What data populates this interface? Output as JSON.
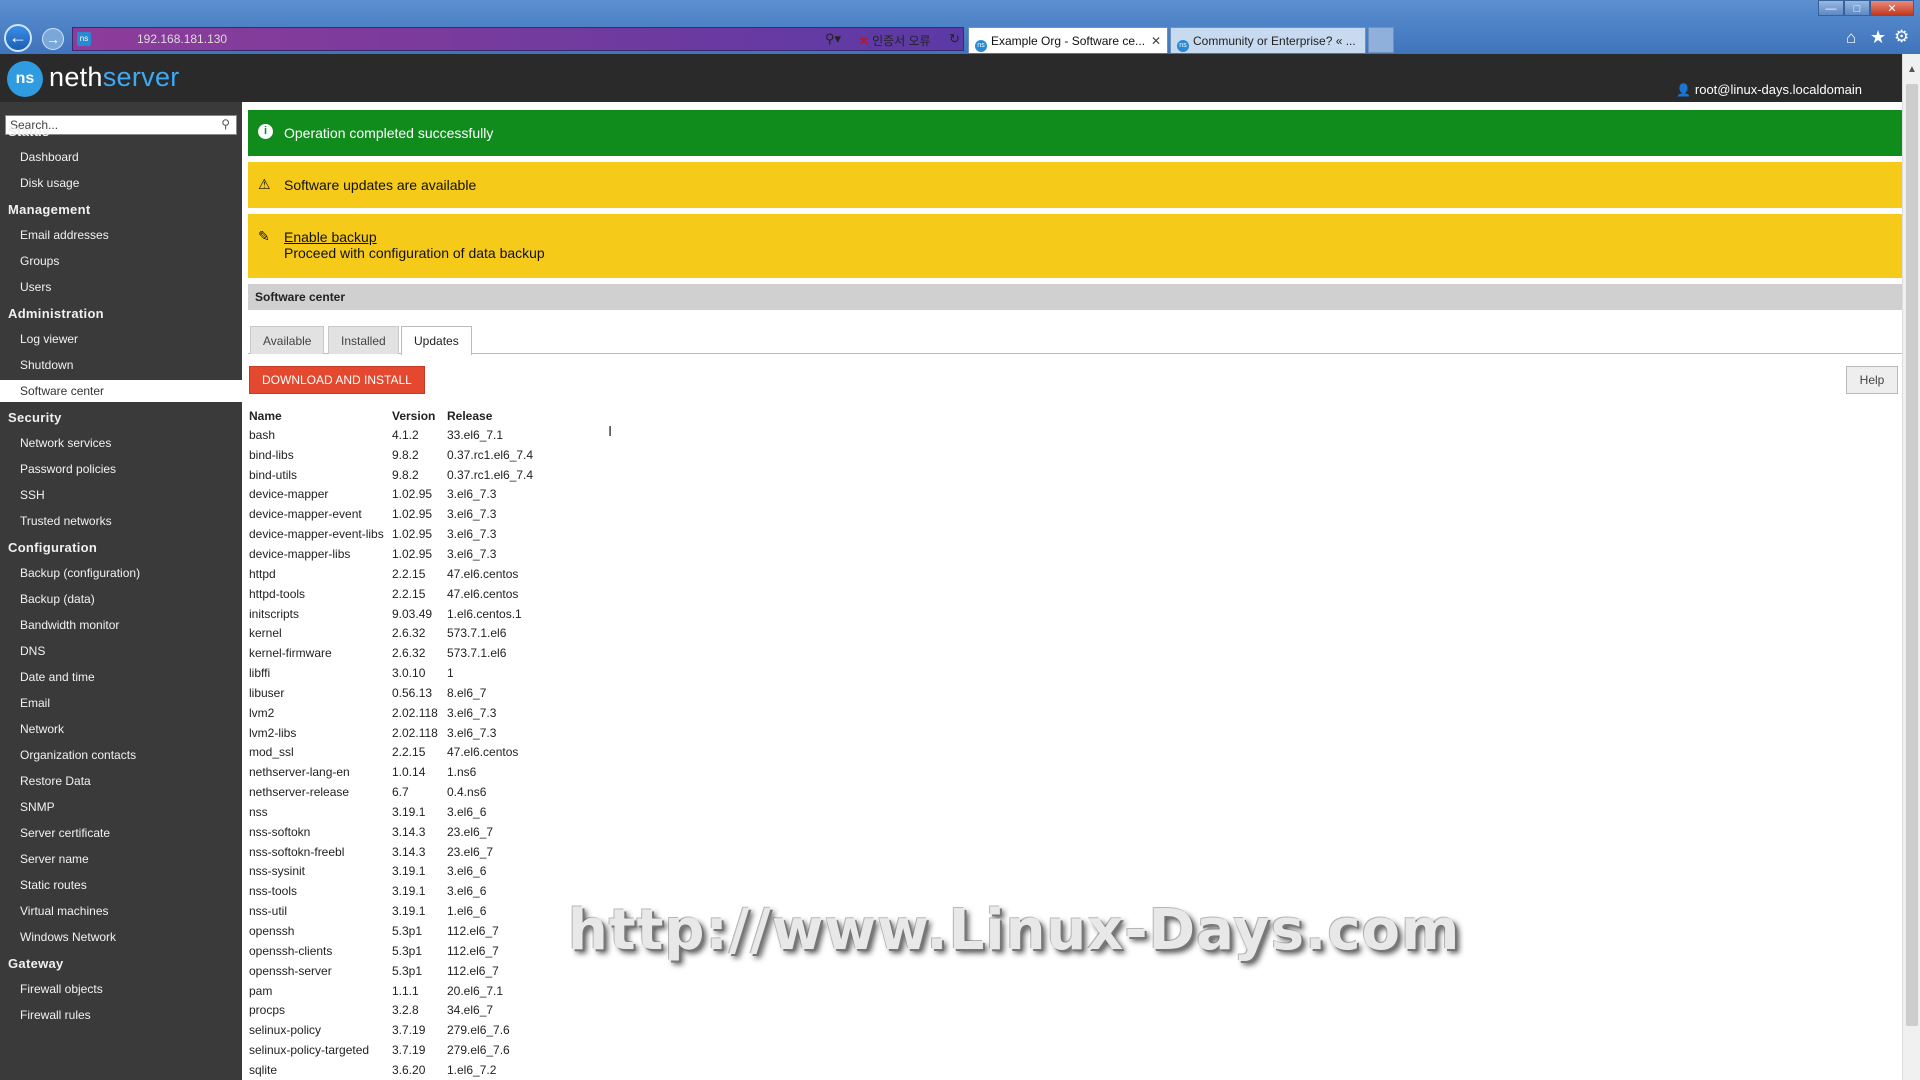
{
  "browser": {
    "url": "192.168.181.130",
    "cert_error": "인증서 오류",
    "tabs": [
      {
        "label": "Example Org - Software ce..."
      },
      {
        "label": "Community or Enterprise? « ..."
      }
    ],
    "icons": [
      "back-icon",
      "forward-icon",
      "search-icon",
      "refresh-icon",
      "home-icon",
      "star-icon",
      "gear-icon"
    ]
  },
  "header": {
    "logo_prefix": "neth",
    "logo_suffix": "server",
    "user": "root@linux-days.localdomain"
  },
  "sidebar": {
    "search_placeholder": "Search...",
    "sections": [
      {
        "title": "Status",
        "items": [
          "Dashboard",
          "Disk usage"
        ]
      },
      {
        "title": "Management",
        "items": [
          "Email addresses",
          "Groups",
          "Users"
        ]
      },
      {
        "title": "Administration",
        "items": [
          "Log viewer",
          "Shutdown",
          "Software center"
        ]
      },
      {
        "title": "Security",
        "items": [
          "Network services",
          "Password policies",
          "SSH",
          "Trusted networks"
        ]
      },
      {
        "title": "Configuration",
        "items": [
          "Backup (configuration)",
          "Backup (data)",
          "Bandwidth monitor",
          "DNS",
          "Date and time",
          "Email",
          "Network",
          "Organization contacts",
          "Restore Data",
          "SNMP",
          "Server certificate",
          "Server name",
          "Static routes",
          "Virtual machines",
          "Windows Network"
        ]
      },
      {
        "title": "Gateway",
        "items": [
          "Firewall objects",
          "Firewall rules"
        ]
      }
    ],
    "active_item": "Software center"
  },
  "alerts": {
    "success": "Operation completed successfully",
    "updates": "Software updates are available",
    "backup_link": "Enable backup",
    "backup_desc": "Proceed with configuration of data backup"
  },
  "panel": {
    "title": "Software center",
    "tabs": [
      "Available",
      "Installed",
      "Updates"
    ],
    "active_tab": "Updates",
    "download_button": "DOWNLOAD AND INSTALL",
    "help_button": "Help"
  },
  "table": {
    "columns": [
      "Name",
      "Version",
      "Release"
    ],
    "rows": [
      [
        "bash",
        "4.1.2",
        "33.el6_7.1"
      ],
      [
        "bind-libs",
        "9.8.2",
        "0.37.rc1.el6_7.4"
      ],
      [
        "bind-utils",
        "9.8.2",
        "0.37.rc1.el6_7.4"
      ],
      [
        "device-mapper",
        "1.02.95",
        "3.el6_7.3"
      ],
      [
        "device-mapper-event",
        "1.02.95",
        "3.el6_7.3"
      ],
      [
        "device-mapper-event-libs",
        "1.02.95",
        "3.el6_7.3"
      ],
      [
        "device-mapper-libs",
        "1.02.95",
        "3.el6_7.3"
      ],
      [
        "httpd",
        "2.2.15",
        "47.el6.centos"
      ],
      [
        "httpd-tools",
        "2.2.15",
        "47.el6.centos"
      ],
      [
        "initscripts",
        "9.03.49",
        "1.el6.centos.1"
      ],
      [
        "kernel",
        "2.6.32",
        "573.7.1.el6"
      ],
      [
        "kernel-firmware",
        "2.6.32",
        "573.7.1.el6"
      ],
      [
        "libffi",
        "3.0.10",
        "1"
      ],
      [
        "libuser",
        "0.56.13",
        "8.el6_7"
      ],
      [
        "lvm2",
        "2.02.118",
        "3.el6_7.3"
      ],
      [
        "lvm2-libs",
        "2.02.118",
        "3.el6_7.3"
      ],
      [
        "mod_ssl",
        "2.2.15",
        "47.el6.centos"
      ],
      [
        "nethserver-lang-en",
        "1.0.14",
        "1.ns6"
      ],
      [
        "nethserver-release",
        "6.7",
        "0.4.ns6"
      ],
      [
        "nss",
        "3.19.1",
        "3.el6_6"
      ],
      [
        "nss-softokn",
        "3.14.3",
        "23.el6_7"
      ],
      [
        "nss-softokn-freebl",
        "3.14.3",
        "23.el6_7"
      ],
      [
        "nss-sysinit",
        "3.19.1",
        "3.el6_6"
      ],
      [
        "nss-tools",
        "3.19.1",
        "3.el6_6"
      ],
      [
        "nss-util",
        "3.19.1",
        "1.el6_6"
      ],
      [
        "openssh",
        "5.3p1",
        "112.el6_7"
      ],
      [
        "openssh-clients",
        "5.3p1",
        "112.el6_7"
      ],
      [
        "openssh-server",
        "5.3p1",
        "112.el6_7"
      ],
      [
        "pam",
        "1.1.1",
        "20.el6_7.1"
      ],
      [
        "procps",
        "3.2.8",
        "34.el6_7"
      ],
      [
        "selinux-policy",
        "3.7.19",
        "279.el6_7.6"
      ],
      [
        "selinux-policy-targeted",
        "3.7.19",
        "279.el6_7.6"
      ],
      [
        "sqlite",
        "3.6.20",
        "1.el6_7.2"
      ]
    ]
  },
  "watermark": "http://www.Linux-Days.com"
}
